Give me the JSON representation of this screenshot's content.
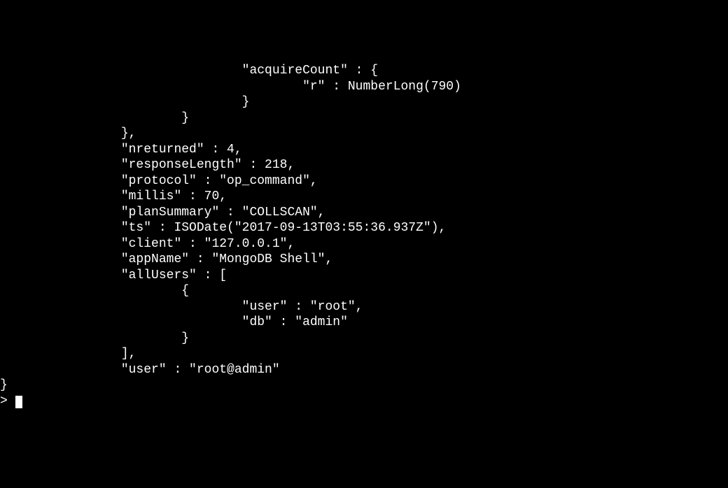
{
  "terminal": {
    "lines": [
      "                                \"acquireCount\" : {",
      "                                        \"r\" : NumberLong(790)",
      "                                }",
      "                        }",
      "                },",
      "                \"nreturned\" : 4,",
      "                \"responseLength\" : 218,",
      "                \"protocol\" : \"op_command\",",
      "                \"millis\" : 70,",
      "                \"planSummary\" : \"COLLSCAN\",",
      "                \"ts\" : ISODate(\"2017-09-13T03:55:36.937Z\"),",
      "                \"client\" : \"127.0.0.1\",",
      "                \"appName\" : \"MongoDB Shell\",",
      "                \"allUsers\" : [",
      "                        {",
      "                                \"user\" : \"root\",",
      "                                \"db\" : \"admin\"",
      "                        }",
      "                ],",
      "                \"user\" : \"root@admin\"",
      "}",
      "> "
    ]
  }
}
